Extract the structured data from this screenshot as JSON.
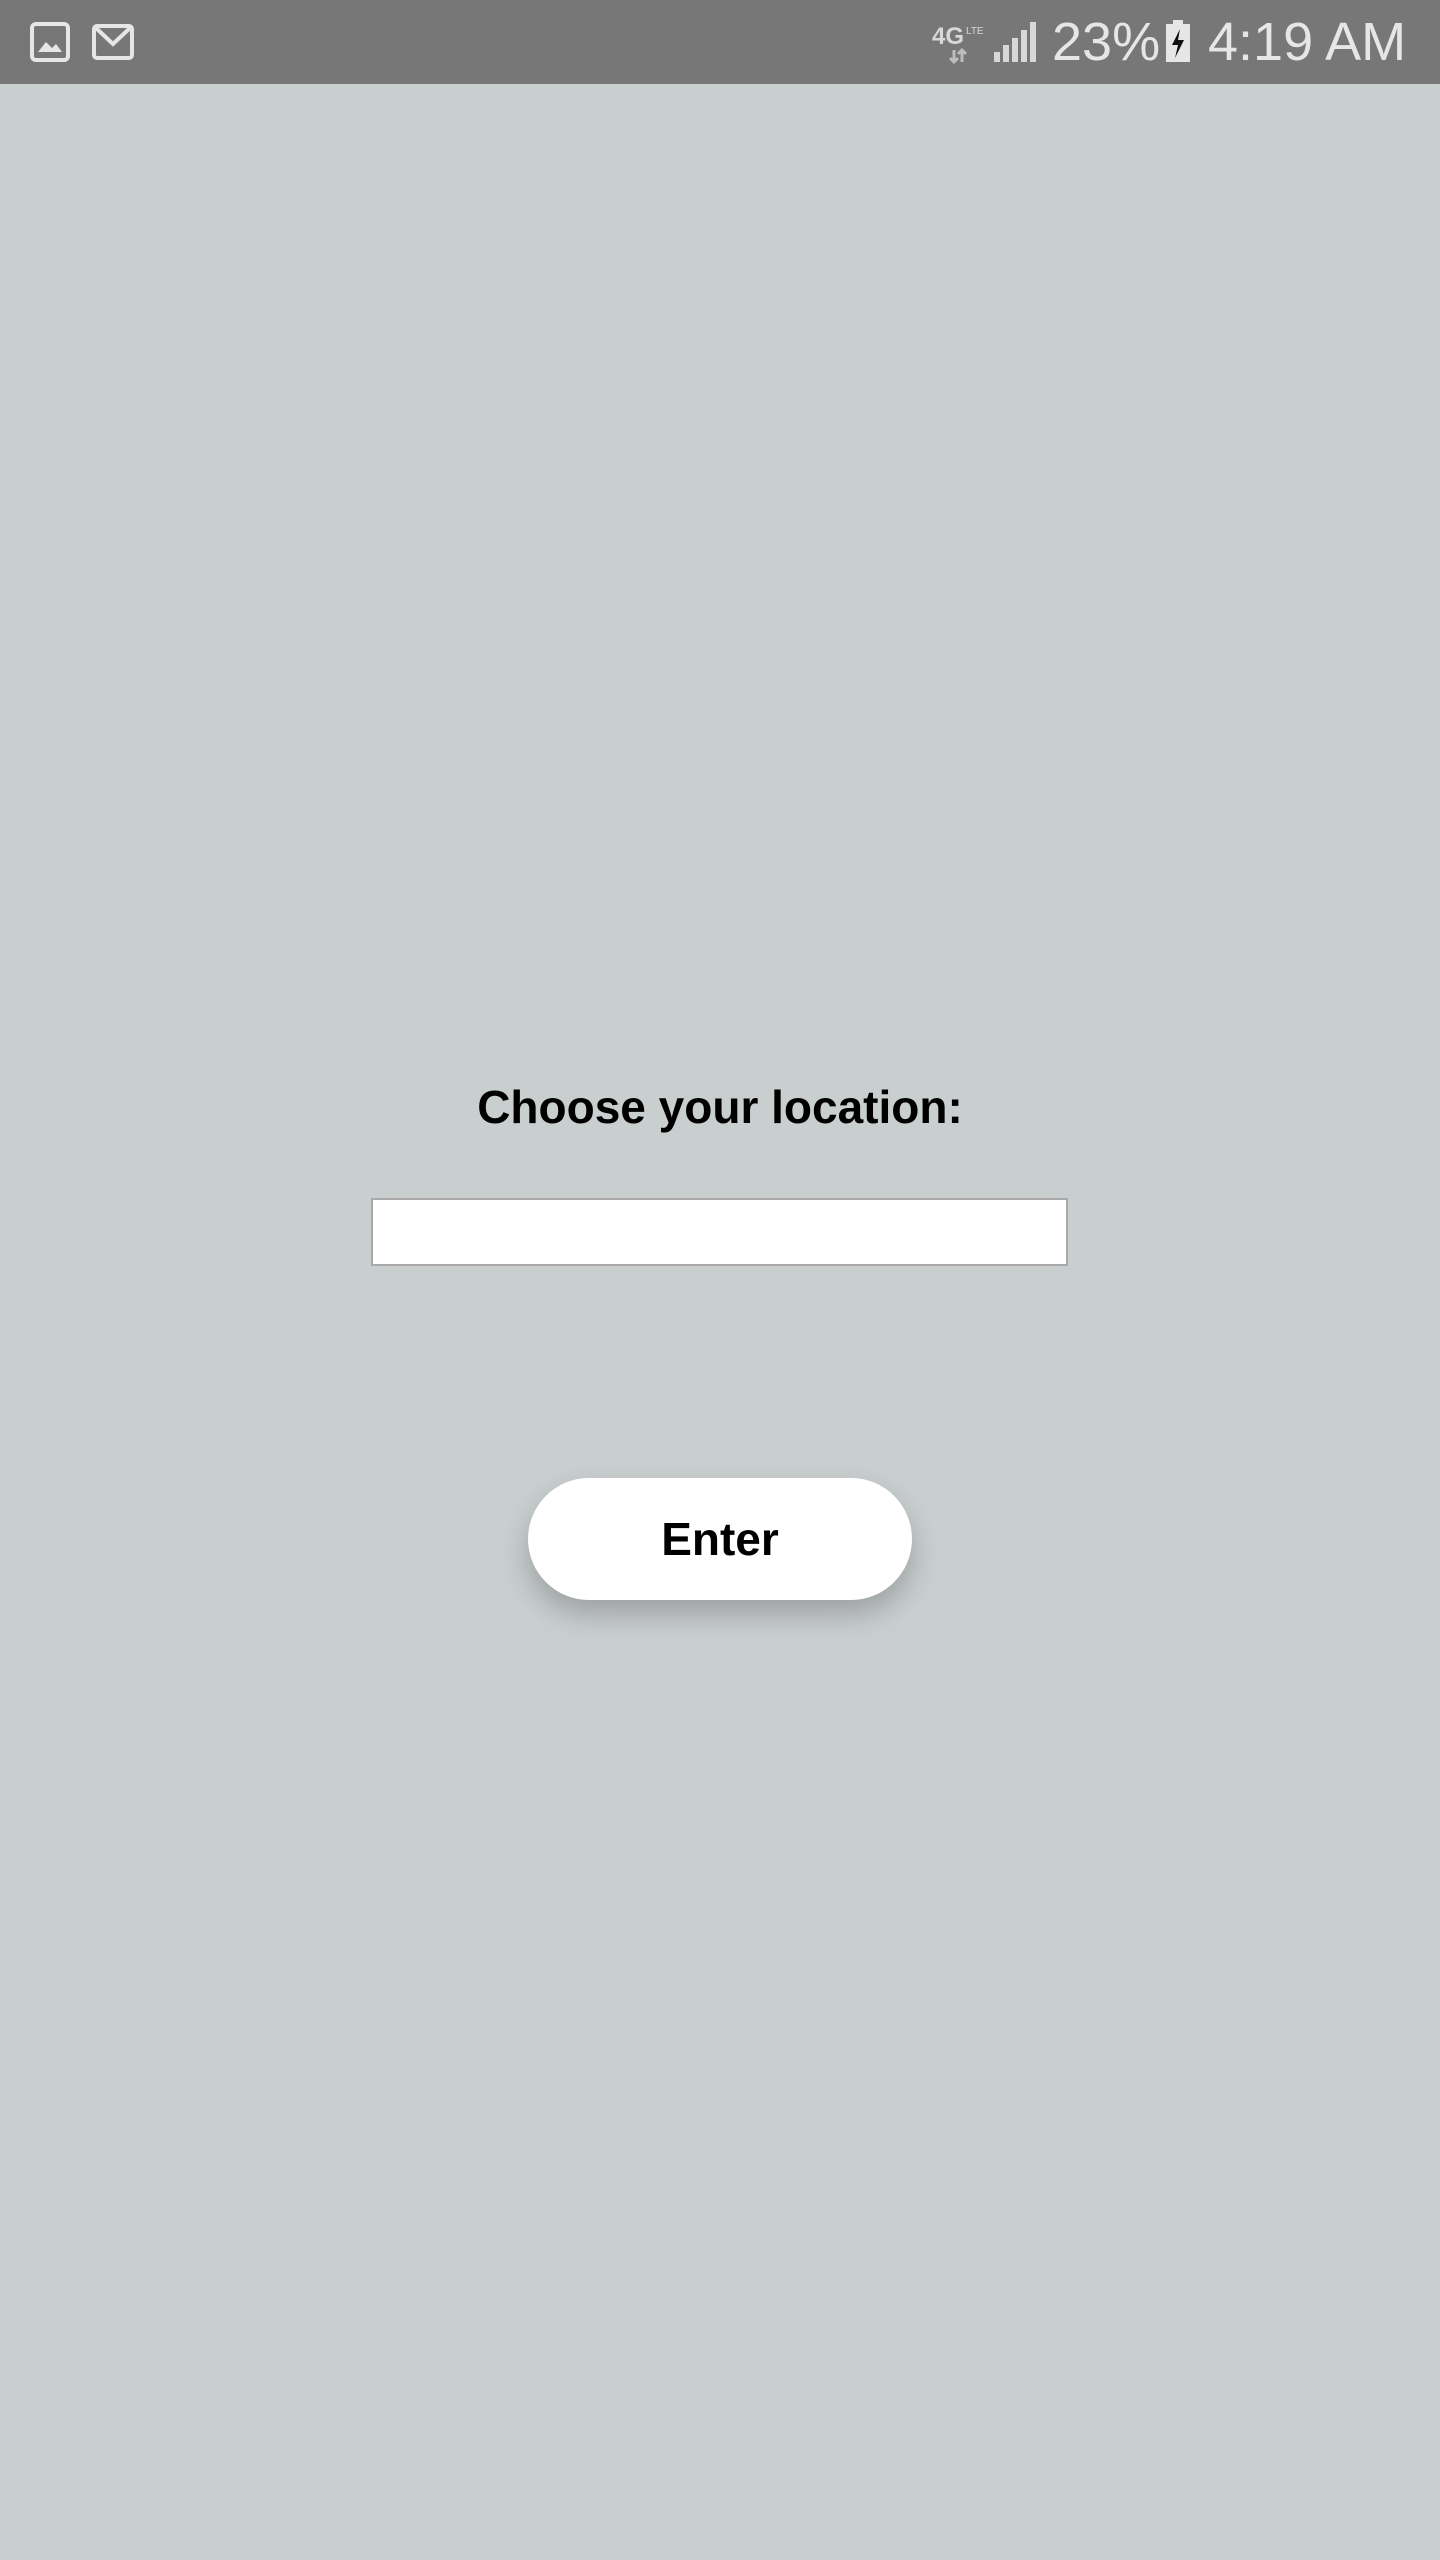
{
  "status_bar": {
    "left_icons": [
      "gallery-icon",
      "gmail-icon"
    ],
    "network_label": "4G",
    "battery_percent": "23%",
    "battery_level": 0.23,
    "time": "4:19 AM",
    "colors": {
      "background": "#777777",
      "foreground": "#e6e6e6"
    }
  },
  "main": {
    "prompt": "Choose your location:",
    "location_input": {
      "value": "",
      "placeholder": ""
    },
    "enter_label": "Enter"
  },
  "colors": {
    "page_background": "#c9cecf",
    "button_background": "#ffffff",
    "input_border": "#a9a9a9"
  }
}
